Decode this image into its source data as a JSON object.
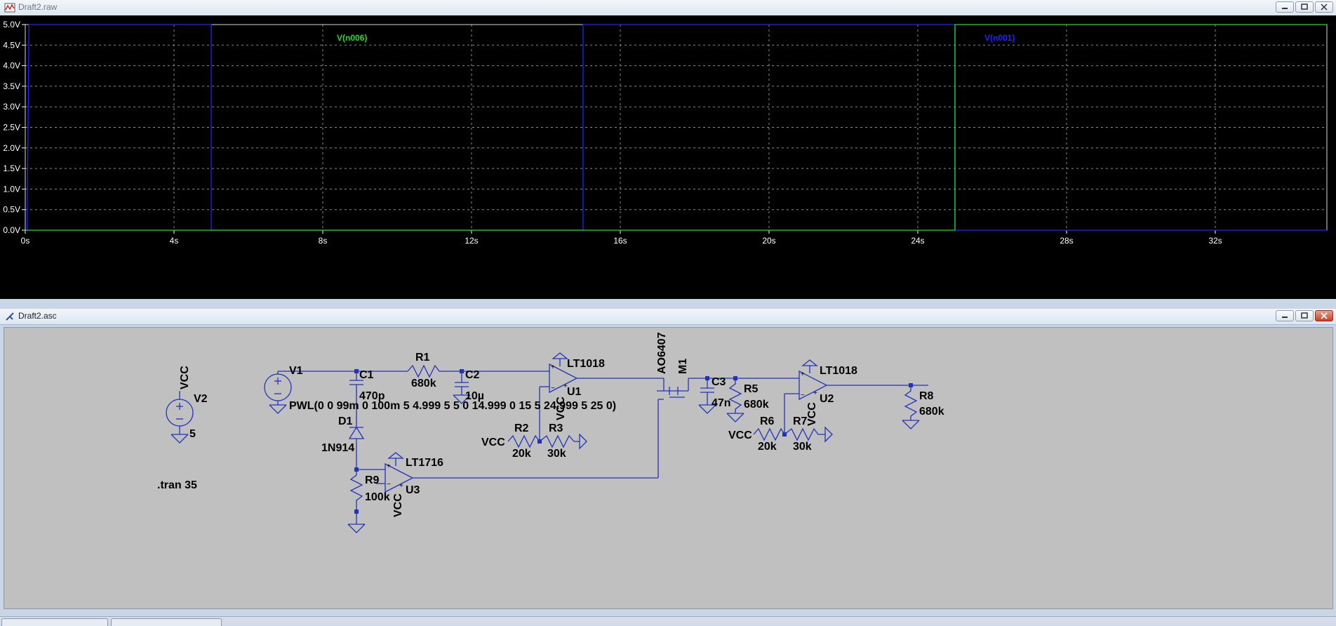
{
  "waveform_window": {
    "title": "Draft2.raw",
    "traces": [
      {
        "name": "V(n006)",
        "color": "#22dd22"
      },
      {
        "name": "V(n001)",
        "color": "#2222ff"
      }
    ],
    "y_axis_ticks": [
      "5.0V",
      "4.5V",
      "4.0V",
      "3.5V",
      "3.0V",
      "2.5V",
      "2.0V",
      "1.5V",
      "1.0V",
      "0.5V",
      "0.0V"
    ],
    "x_axis_ticks": [
      "0s",
      "4s",
      "8s",
      "12s",
      "16s",
      "20s",
      "24s",
      "28s",
      "32s"
    ]
  },
  "chart_data": {
    "type": "line",
    "xlabel": "",
    "ylabel": "",
    "xlim": [
      0,
      35
    ],
    "ylim": [
      0,
      5
    ],
    "x_ticks": [
      "0s",
      "4s",
      "8s",
      "12s",
      "16s",
      "20s",
      "24s",
      "28s",
      "32s"
    ],
    "y_ticks": [
      "0.0V",
      "0.5V",
      "1.0V",
      "1.5V",
      "2.0V",
      "2.5V",
      "3.0V",
      "3.5V",
      "4.0V",
      "4.5V",
      "5.0V"
    ],
    "grid": true,
    "series": [
      {
        "name": "V(n001)",
        "color": "#2222ff",
        "x": [
          0,
          0.05,
          0.1,
          5.0,
          5.0,
          15.0,
          15.0,
          25.0,
          25.0,
          35
        ],
        "y": [
          0,
          0,
          5,
          5,
          0,
          0,
          5,
          5,
          0,
          0
        ]
      },
      {
        "name": "V(n006)",
        "color": "#22dd22",
        "x": [
          0,
          5.0,
          5.0,
          15.0,
          15.0,
          25.0,
          25.0,
          35
        ],
        "y": [
          0,
          0,
          0,
          0,
          0,
          0,
          5,
          5
        ]
      }
    ]
  },
  "schematic_window": {
    "title": "Draft2.asc",
    "labels": {
      "vcc_top": "VCC",
      "v2": "V2",
      "v2_value": "5",
      "v1": "V1",
      "c1": "C1",
      "c1_value": "470p",
      "r1": "R1",
      "r1_value": "680k",
      "c2": "C2",
      "c2_value": "10µ",
      "pwl": "PWL(0 0 99m 0 100m 5 4.999 5 5 0 14.999 0 15 5 24.999 5 25 0)",
      "d1": "D1",
      "d1_value": "1N914",
      "lt1018_u1": "LT1018",
      "u1": "U1",
      "vcc_u1": "VCC",
      "r2": "R2",
      "r2_value": "20k",
      "vcc_r2": "VCC",
      "r3": "R3",
      "r3_value": "30k",
      "lt1716": "LT1716",
      "u3": "U3",
      "vcc_u3": "VCC",
      "r9": "R9",
      "r9_value": "100k",
      "ao6407": "AO6407",
      "m1": "M1",
      "c3": "C3",
      "c3_value": "47n",
      "r5": "R5",
      "r5_value": "680k",
      "r6": "R6",
      "r6_value": "20k",
      "vcc_r6": "VCC",
      "r7": "R7",
      "r7_value": "30k",
      "lt1018_u2": "LT1018",
      "u2": "U2",
      "vcc_u2": "VCC",
      "r8": "R8",
      "r8_value": "680k",
      "tran": ".tran 35"
    }
  }
}
